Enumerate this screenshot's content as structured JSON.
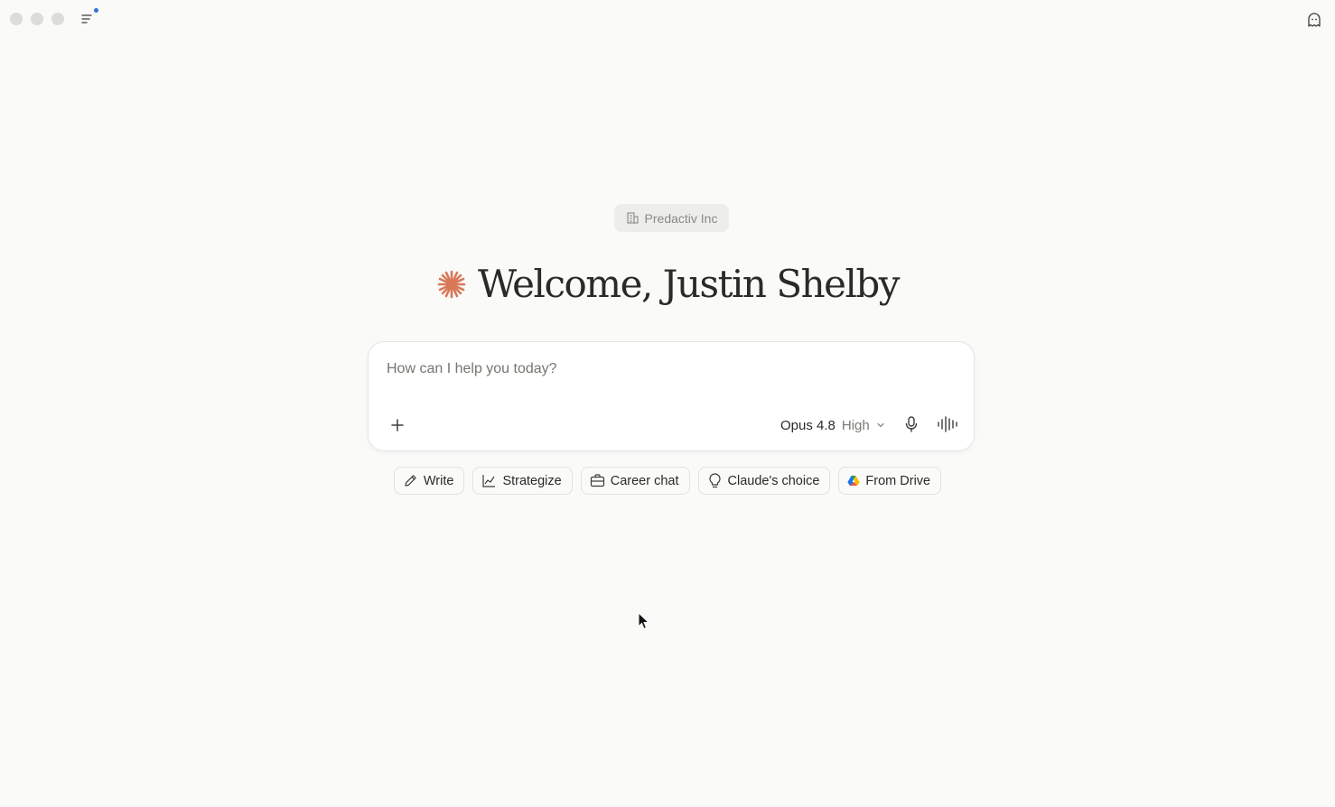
{
  "titlebar": {
    "sidebar_toggle_icon": "sidebar-toggle-icon",
    "right_icon": "ghost-icon"
  },
  "org": {
    "name": "Predactiv Inc",
    "icon": "building-icon"
  },
  "welcome": {
    "text": "Welcome, Justin Shelby",
    "logo_color": "#d97757"
  },
  "composer": {
    "placeholder": "How can I help you today?",
    "value": "",
    "model": "Opus 4.8",
    "effort": "High"
  },
  "chips": [
    {
      "label": "Write",
      "icon": "pencil-icon"
    },
    {
      "label": "Strategize",
      "icon": "chart-icon"
    },
    {
      "label": "Career chat",
      "icon": "briefcase-icon"
    },
    {
      "label": "Claude's choice",
      "icon": "lightbulb-icon"
    },
    {
      "label": "From Drive",
      "icon": "google-drive-icon"
    }
  ],
  "colors": {
    "background": "#fafaf9",
    "accent": "#d97757",
    "notification_dot": "#2f6fde"
  }
}
